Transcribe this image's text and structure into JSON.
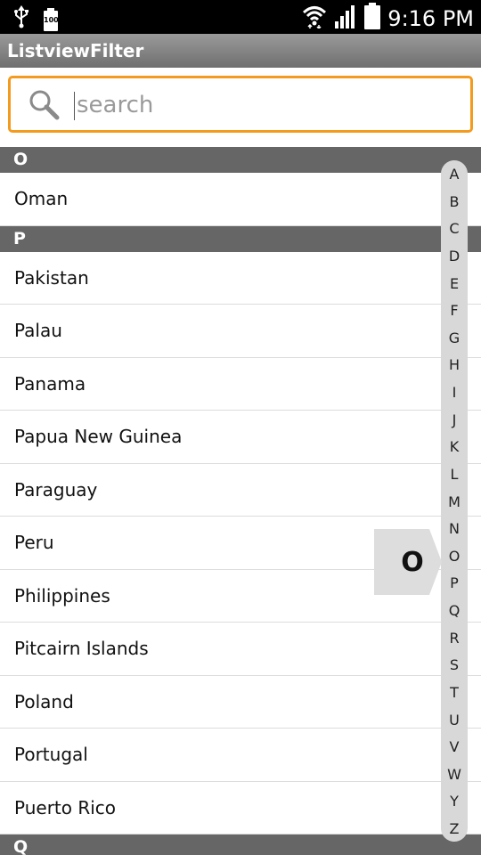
{
  "status_bar": {
    "time": "9:16 PM",
    "battery_small_label": "100",
    "icons": [
      "usb-icon",
      "battery-small-icon",
      "wifi-icon",
      "signal-icon",
      "battery-icon"
    ]
  },
  "app": {
    "title": "ListviewFilter"
  },
  "search": {
    "placeholder": "search",
    "value": "",
    "border_color": "#f39a1f"
  },
  "list": {
    "rows": [
      {
        "type": "header",
        "label": "O"
      },
      {
        "type": "item",
        "label": "Oman"
      },
      {
        "type": "header",
        "label": "P"
      },
      {
        "type": "item",
        "label": "Pakistan"
      },
      {
        "type": "item",
        "label": "Palau"
      },
      {
        "type": "item",
        "label": "Panama"
      },
      {
        "type": "item",
        "label": "Papua New Guinea"
      },
      {
        "type": "item",
        "label": "Paraguay"
      },
      {
        "type": "item",
        "label": "Peru"
      },
      {
        "type": "item",
        "label": "Philippines"
      },
      {
        "type": "item",
        "label": "Pitcairn Islands"
      },
      {
        "type": "item",
        "label": "Poland"
      },
      {
        "type": "item",
        "label": "Portugal"
      },
      {
        "type": "item",
        "label": "Puerto Rico"
      },
      {
        "type": "header",
        "label": "Q"
      }
    ]
  },
  "alphabet_index": [
    "A",
    "B",
    "C",
    "D",
    "E",
    "F",
    "G",
    "H",
    "I",
    "J",
    "K",
    "L",
    "M",
    "N",
    "O",
    "P",
    "Q",
    "R",
    "S",
    "T",
    "U",
    "V",
    "W",
    "Y",
    "Z"
  ],
  "preview": {
    "letter": "O"
  },
  "colors": {
    "section_header_bg": "#666666",
    "action_bar_bg": "#7f7f7f",
    "index_bg": "#d8d8d8",
    "preview_bg": "#dddddd"
  }
}
